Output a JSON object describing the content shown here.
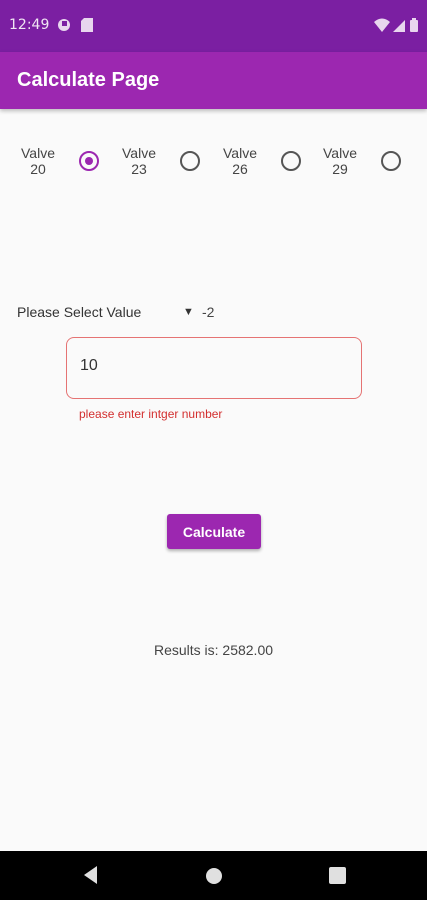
{
  "status_bar": {
    "time": "12:49",
    "icons": [
      "notification-icon",
      "sim-card-icon",
      "wifi-icon",
      "signal-icon",
      "battery-icon"
    ]
  },
  "app_bar": {
    "title": "Calculate Page",
    "color": "#9c27b0"
  },
  "radios": [
    {
      "label": "Valve\n20",
      "line1": "Valve",
      "line2": "20",
      "selected": true
    },
    {
      "label": "Valve\n23",
      "line1": "Valve",
      "line2": "23",
      "selected": false
    },
    {
      "label": "Valve\n26",
      "line1": "Valve",
      "line2": "26",
      "selected": false
    },
    {
      "label": "Valve\n29",
      "line1": "Valve",
      "line2": "29",
      "selected": false
    }
  ],
  "dropdown": {
    "label": "Please Select Value",
    "value": "-2"
  },
  "input": {
    "value": "10",
    "error": "please enter intger number",
    "error_color": "#d32f2f"
  },
  "button": {
    "label": "Calculate"
  },
  "result": {
    "text": "Results is: 2582.00"
  },
  "nav_bar": {
    "icons": [
      "back-icon",
      "home-icon",
      "recents-icon"
    ]
  }
}
